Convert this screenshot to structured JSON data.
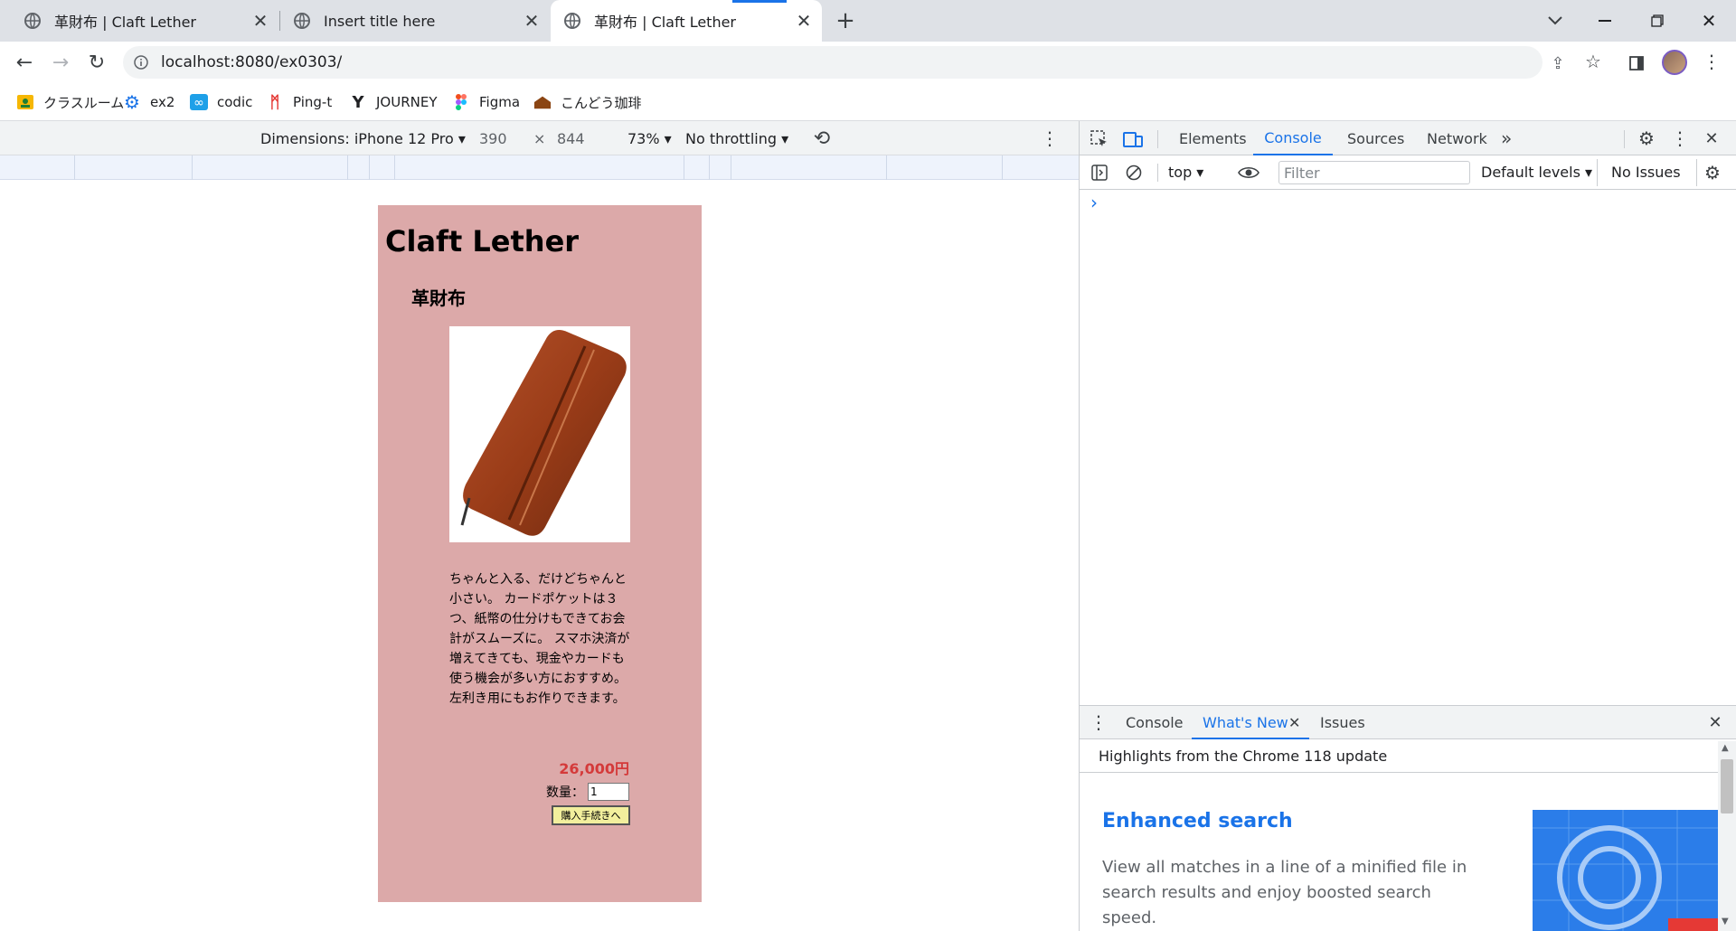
{
  "browser": {
    "tabs": [
      {
        "title": "革財布 | Claft Lether"
      },
      {
        "title": "Insert title here"
      },
      {
        "title": "革財布 | Claft Lether"
      }
    ],
    "url": "localhost:8080/ex0303/",
    "bookmarks": [
      {
        "label": "クラスルーム",
        "icon": "classroom-icon"
      },
      {
        "label": "ex2",
        "icon": "gear-icon"
      },
      {
        "label": "codic",
        "icon": "infinity-icon"
      },
      {
        "label": "Ping-t",
        "icon": "ping-icon"
      },
      {
        "label": "JOURNEY",
        "icon": "journey-icon"
      },
      {
        "label": "Figma",
        "icon": "figma-icon"
      },
      {
        "label": "こんどう珈琲",
        "icon": "cafe-icon"
      }
    ]
  },
  "device_toolbar": {
    "dimensions": "Dimensions: iPhone 12 Pro",
    "width": "390",
    "times": "×",
    "height": "844",
    "zoom": "73%",
    "throttling": "No throttling"
  },
  "page": {
    "title": "Claft Lether",
    "product_name": "革財布",
    "description": "ちゃんと入る、だけどちゃんと小さい。 カードポケットは３つ、紙幣の仕分けもできてお会計がスムーズに。 スマホ決済が増えてきても、現金やカードも使う機会が多い方におすすめ。 左利き用にもお作りできます。",
    "price": "26,000円",
    "quantity_label": "数量：",
    "quantity_value": "1",
    "buy_button": "購入手続きへ",
    "colors": {
      "background": "#dca9a9",
      "price": "#d43a3a",
      "button": "#f2ef9d"
    }
  },
  "devtools": {
    "tabs": [
      "Elements",
      "Console",
      "Sources",
      "Network"
    ],
    "active_tab": "Console",
    "context": "top",
    "filter_placeholder": "Filter",
    "levels": "Default levels",
    "issues": "No Issues",
    "prompt": "›",
    "drawer": {
      "tabs": [
        "Console",
        "What's New",
        "Issues"
      ],
      "active_tab": "What's New",
      "header": "Highlights from the Chrome 118 update",
      "feature_title": "Enhanced search",
      "feature_text": "View all matches in a line of a minified file in search results and enjoy boosted search speed."
    }
  }
}
